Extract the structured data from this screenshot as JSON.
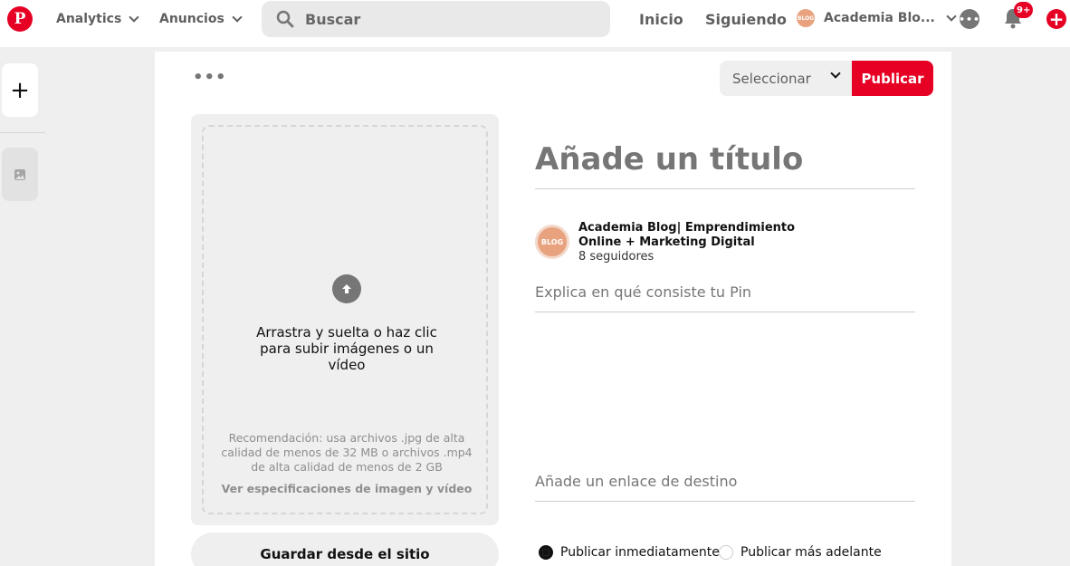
{
  "header": {
    "logo": "P",
    "nav_analytics": "Analytics",
    "nav_ads": "Anuncios",
    "search_placeholder": "Buscar",
    "nav_home": "Inicio",
    "nav_following": "Siguiendo",
    "account_name": "Academia Blo...",
    "account_avatar_text": "BLOG",
    "messages_icon_text": "•••",
    "notifications_badge": "9+",
    "add_icon_text": "+"
  },
  "sidebar": {
    "add_label": "+"
  },
  "editor": {
    "more_dots": "•••",
    "board_select": "Seleccionar",
    "publish_label": "Publicar",
    "upload_text": "Arrastra y suelta o haz clic para subir imágenes o un vídeo",
    "recommendation": "Recomendación: usa archivos .jpg de alta calidad de menos de 32 MB o archivos .mp4 de alta calidad de menos de 2 GB",
    "specs_link": "Ver especificaciones de imagen y vídeo",
    "save_from_site": "Guardar desde el sitio",
    "title_placeholder": "Añade un título",
    "profile_avatar_text": "BLOG",
    "profile_name": "Academia Blog| Emprendimiento Online + Marketing Digital",
    "profile_followers": "8 seguidores",
    "description_placeholder": "Explica en qué consiste tu Pin",
    "link_placeholder": "Añade un enlace de destino",
    "publish_now": "Publicar inmediatamente",
    "publish_later": "Publicar más adelante"
  },
  "colors": {
    "brand": "#e60023",
    "icon_gray": "#767676"
  }
}
